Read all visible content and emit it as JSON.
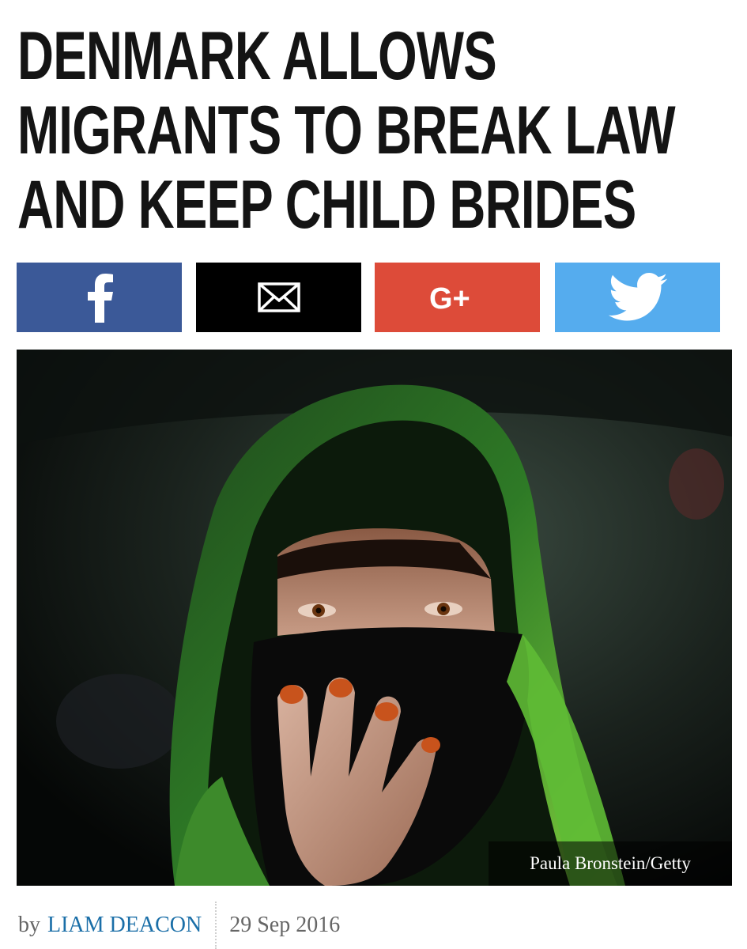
{
  "headline": {
    "line1": "DENMARK ALLOWS",
    "line2": "MIGRANTS TO BREAK LAW",
    "line3": "AND KEEP CHILD BRIDES"
  },
  "share": {
    "buttons": [
      {
        "network": "facebook",
        "icon": "facebook-icon",
        "color": "#3b5998"
      },
      {
        "network": "email",
        "icon": "envelope-icon",
        "color": "#000000"
      },
      {
        "network": "google-plus",
        "icon": "google-plus-icon",
        "color": "#dd4b39",
        "label": "G+"
      },
      {
        "network": "twitter",
        "icon": "twitter-bird-icon",
        "color": "#55acee"
      }
    ]
  },
  "photo": {
    "credit": "Paula Bronstein/Getty"
  },
  "byline": {
    "prefix": "by",
    "author": "LIAM DEACON",
    "date": "29 Sep 2016"
  },
  "colors": {
    "headline": "#141414",
    "author_link": "#1b6fa8",
    "meta_text": "#666666"
  }
}
